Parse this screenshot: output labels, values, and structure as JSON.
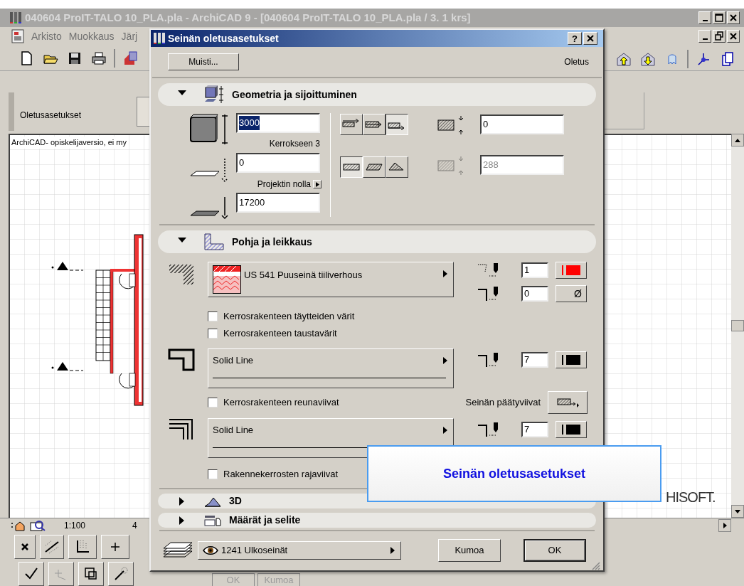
{
  "app": {
    "title": "040604 ProIT-TALO 10_PLA.pla - ArchiCAD 9 - [040604 ProIT-TALO 10_PLA.pla / 3. 1 krs]",
    "menu": [
      "Arkisto",
      "Muokkaus",
      "Järj"
    ],
    "info_label": "Oletusasetukset",
    "canvas_note": "ArchiCAD- opiskelijaversio, ei my",
    "logo_text": "HISOFT.",
    "scale": "1:100",
    "status_cut": "4",
    "hidden_buttons": [
      {
        "label": "OK",
        "disabled": true
      },
      {
        "label": "Kumoa",
        "disabled": true
      }
    ]
  },
  "dialog": {
    "title": "Seinän oletusasetukset",
    "help_button": "?",
    "favorites_button": "Muisti...",
    "default_label": "Oletus",
    "sections": [
      {
        "title": "Geometria ja sijoittuminen",
        "expanded": true
      },
      {
        "title": "Pohja ja leikkaus",
        "expanded": true
      },
      {
        "title": "3D",
        "expanded": false
      },
      {
        "title": "Määrät ja selite",
        "expanded": false
      }
    ],
    "geometry": {
      "fields": [
        {
          "value": "3000",
          "highlighted": true
        },
        {
          "value": "0",
          "highlighted": false
        },
        {
          "value": "17200",
          "highlighted": false
        }
      ],
      "top_link": "Kerrokseen 3",
      "bottom_link": "Projektin nolla",
      "reference_buttons": [
        {
          "selected": false
        },
        {
          "selected": false
        },
        {
          "selected": true
        }
      ],
      "composite_buttons": [
        {
          "selected": true
        },
        {
          "selected": false
        },
        {
          "selected": false
        }
      ],
      "side_fields": [
        {
          "value": "0",
          "disabled": false
        },
        {
          "value": "288",
          "disabled": true
        }
      ]
    },
    "floor_plan": [
      {
        "kind": "fill",
        "label": "US 541 Puuseinä tiiliverhous",
        "pens": [
          {
            "value": "1",
            "color": "#ff0000"
          },
          {
            "value": "0",
            "symbol": "Ø"
          }
        ]
      },
      {
        "kind": "checkbox",
        "label": "Kerrosrakenteen täytteiden värit",
        "checked": false
      },
      {
        "kind": "checkbox",
        "label": "Kerrosrakenteen taustavärit",
        "checked": false
      },
      {
        "kind": "line",
        "label": "Solid Line",
        "pens": [
          {
            "value": "7",
            "color": "#000000"
          }
        ]
      },
      {
        "kind": "checkbox",
        "label": "Kerrosrakenteen reunaviivat",
        "checked": false,
        "extra_label": "Seinän päätyviivat"
      },
      {
        "kind": "line",
        "label": "Solid Line",
        "pens": [
          {
            "value": "7",
            "color": "#000000"
          }
        ]
      },
      {
        "kind": "checkbox",
        "label": "Rakennekerrosten rajaviivat",
        "checked": false
      }
    ],
    "layer": "1241 Ulkoseinät",
    "buttons": [
      {
        "label": "Kumoa",
        "default": false
      },
      {
        "label": "OK",
        "default": true
      }
    ]
  },
  "callout": {
    "text": "Seinän oletusasetukset"
  }
}
